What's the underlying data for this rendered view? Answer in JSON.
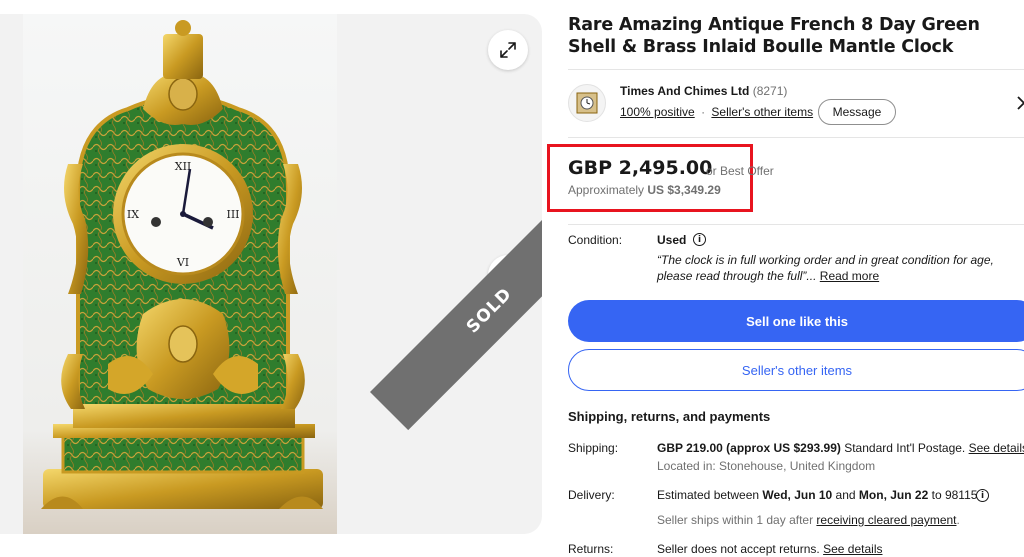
{
  "listing": {
    "title": "Rare Amazing Antique French 8 Day Green Shell & Brass Inlaid Boulle Mantle Clock",
    "sold_badge": "SOLD"
  },
  "gallery": {
    "photo_icon": "clock-photo",
    "expand_icon": "expand-icon",
    "next_icon": "chevron-right-icon"
  },
  "seller": {
    "name": "Times And Chimes Ltd",
    "feedback_count": "(8271)",
    "positive": "100% positive",
    "separator": "·",
    "other_items_link": "Seller's other items",
    "message_label": "Message",
    "chevron_icon": "chevron-right-icon"
  },
  "price": {
    "main": "GBP 2,495.00",
    "best_offer": "or Best Offer",
    "approx_prefix": "Approximately",
    "approx_value": "US $3,349.29"
  },
  "condition": {
    "label": "Condition:",
    "value": "Used",
    "quote": "“The clock is in full working order and in great condition for age, please read through the full”...",
    "read_more": "Read more"
  },
  "actions": {
    "sell_like_this": "Sell one like this",
    "sellers_other_items": "Seller's other items"
  },
  "shipping": {
    "section_title": "Shipping, returns, and payments",
    "shipping_label": "Shipping:",
    "shipping_cost": "GBP 219.00 (approx US $293.99)",
    "shipping_method": "Standard Int'l Postage.",
    "see_details": "See details",
    "located_in": "Located in: Stonehouse, United Kingdom",
    "delivery_label": "Delivery:",
    "delivery_prefix": "Estimated between",
    "delivery_start": "Wed, Jun 10",
    "delivery_and": "and",
    "delivery_end": "Mon, Jun 22",
    "delivery_to": "to 98115",
    "ships_within": "Seller ships within 1 day after",
    "cleared_payment": "receiving cleared payment",
    "period": ".",
    "returns_label": "Returns:",
    "returns_text": "Seller does not accept returns.",
    "returns_link": "See details"
  },
  "colors": {
    "accent_blue": "#3665f3",
    "highlight_red": "#e8141f",
    "sold_ribbon": "#707070",
    "clock_green": "#2e7d32",
    "brass_gold": "#d4a629"
  }
}
